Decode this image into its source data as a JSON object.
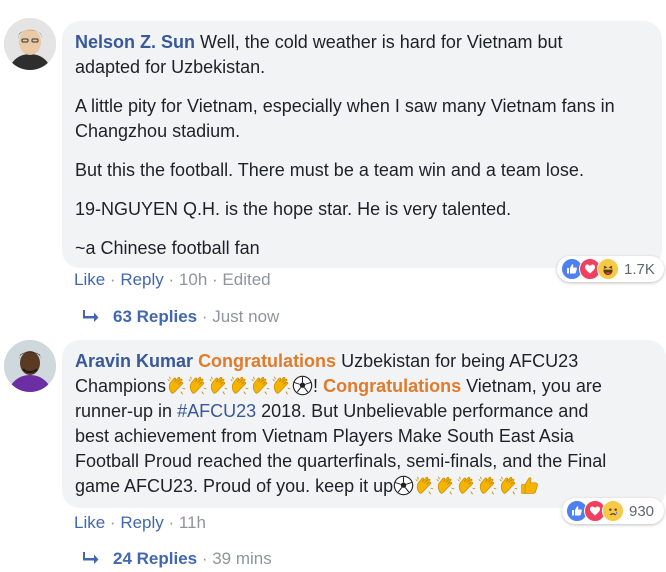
{
  "comments": [
    {
      "author": "Nelson Z. Sun",
      "paragraphs": [
        "Well, the cold weather is hard for Vietnam but",
        "adapted for Uzbekistan.",
        "A little pity for Vietnam, especially when I saw many Vietnam fans in",
        "Changzhou stadium.",
        "But this the football. There must be a team win and a team lose.",
        "19-NGUYEN Q.H. is the hope star. He is very talented.",
        "~a Chinese football fan"
      ],
      "actions": {
        "like": "Like",
        "reply": "Reply",
        "time": "10h",
        "edited": "Edited"
      },
      "reactions": {
        "icons": [
          "like-icon",
          "love-icon",
          "haha-icon"
        ],
        "count": "1.7K"
      },
      "replies": {
        "count": "63 Replies",
        "time": "Just now"
      }
    },
    {
      "author": "Aravin Kumar",
      "segments": {
        "congrats": "Congratulations",
        "t1": "Uzbekistan for being AFCU23",
        "t2": "Champions",
        "t3": "!",
        "t4": "Vietnam, you are",
        "t5": "runner-up in",
        "hashtag": "#AFCU23",
        "t6": "2018. But Unbelievable performance and",
        "t7": "best achievement from Vietnam Players Make South East Asia",
        "t8": "Football Proud reached the quarterfinals, semi-finals, and the Final",
        "t9": "game AFCU23. Proud of you. keep it up"
      },
      "emoji": {
        "clap": "clapping-hands-icon",
        "ball": "soccer-ball-icon",
        "thumb": "thumbs-up-icon"
      },
      "actions": {
        "like": "Like",
        "reply": "Reply",
        "time": "11h"
      },
      "reactions": {
        "icons": [
          "like-icon",
          "love-icon",
          "sad-icon"
        ],
        "count": "930"
      },
      "replies": {
        "count": "24 Replies",
        "time": "39 mins"
      }
    }
  ],
  "colors": {
    "name": "#385898",
    "highlight": "#e07b2c",
    "link": "#4267b2",
    "meta": "#90949c",
    "bubble": "#f2f3f5"
  }
}
